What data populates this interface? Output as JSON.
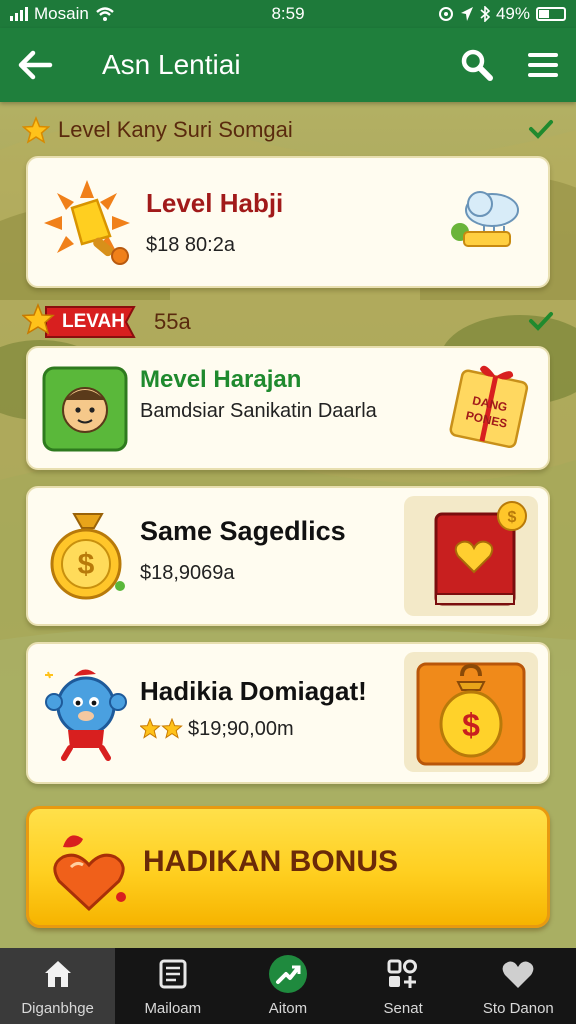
{
  "status_bar": {
    "carrier": "Mosain",
    "time": "8:59",
    "battery": "49%"
  },
  "app_bar": {
    "title": "Asn Lentiai",
    "icons": [
      "back-arrow-icon",
      "search-icon",
      "menu-icon"
    ]
  },
  "sections": [
    {
      "label": "Level Kany Suri Somgai",
      "icon": "star-icon",
      "completed": true
    },
    {
      "label": "55a",
      "badge": "LEVAH",
      "icon": "star-badge-icon",
      "completed": true
    }
  ],
  "cards": [
    {
      "title": "Level Habji",
      "subtitle": "$18 80:2a",
      "title_color": "#a11a1a",
      "left_icon": "sun-trophy-icon",
      "right_icon": "cloud-key-icon"
    },
    {
      "title": "Mevel Harajan",
      "subtitle": "Bamdsiar Sanikatin Daarla",
      "title_color": "#1f8a2e",
      "left_icon": "character-face-icon",
      "right_icon": "gift-coupon-icon",
      "right_icon_text": "DANG PONES"
    },
    {
      "title": "Same Sagedlics",
      "subtitle": "$18,9069a",
      "title_color": "#111111",
      "left_icon": "money-bag-icon",
      "right_icon": "heart-book-icon"
    },
    {
      "title": "Hadikia Domiagat!",
      "subtitle": "$19;90,00m",
      "title_color": "#111111",
      "left_icon": "blue-monster-icon",
      "rating_stars": 2,
      "right_icon": "money-sack-icon"
    }
  ],
  "bonus_button": {
    "label": "HADIKAN BONUS",
    "icon": "heart-gift-icon"
  },
  "bottom_nav": [
    {
      "label": "Diganbhge",
      "icon": "home-icon",
      "active": true
    },
    {
      "label": "Mailoam",
      "icon": "document-icon",
      "active": false
    },
    {
      "label": "Aitom",
      "icon": "trend-icon",
      "active": false
    },
    {
      "label": "Senat",
      "icon": "grid-icon",
      "active": false
    },
    {
      "label": "Sto Danon",
      "icon": "heart-icon",
      "active": false
    }
  ],
  "colors": {
    "primary_green": "#1f7f3c",
    "bonus_yellow": "#ffcf20",
    "card_bg": "#fffcf0"
  }
}
